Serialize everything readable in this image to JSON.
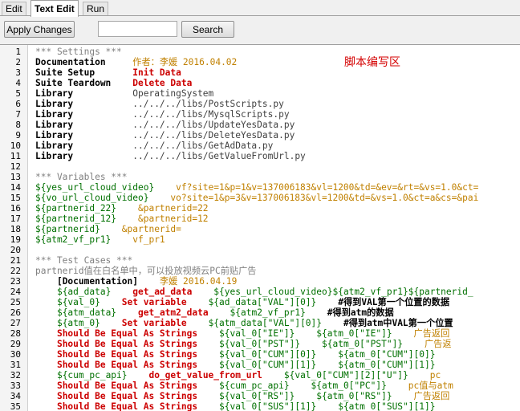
{
  "tabs": {
    "edit": "Edit",
    "text_edit": "Text Edit",
    "run": "Run"
  },
  "toolbar": {
    "apply": "Apply Changes",
    "search_value": "",
    "search": "Search"
  },
  "annotation": "脚本编写区",
  "lines": [
    [
      [
        "cmt",
        "*** Settings ***"
      ]
    ],
    [
      [
        "kw",
        "Documentation     "
      ],
      [
        "arg",
        "作者：李媛 2016.04.02"
      ]
    ],
    [
      [
        "kw",
        "Suite Setup       "
      ],
      [
        "red",
        "Init Data"
      ]
    ],
    [
      [
        "kw",
        "Suite Teardown    "
      ],
      [
        "red",
        "Delete Data"
      ]
    ],
    [
      [
        "kw",
        "Library           "
      ],
      [
        "plain",
        "OperatingSystem"
      ]
    ],
    [
      [
        "kw",
        "Library           "
      ],
      [
        "plain",
        "../../../libs/PostScripts.py"
      ]
    ],
    [
      [
        "kw",
        "Library           "
      ],
      [
        "plain",
        "../../../libs/MysqlScripts.py"
      ]
    ],
    [
      [
        "kw",
        "Library           "
      ],
      [
        "plain",
        "../../../libs/UpdateYesData.py"
      ]
    ],
    [
      [
        "kw",
        "Library           "
      ],
      [
        "plain",
        "../../../libs/DeleteYesData.py"
      ]
    ],
    [
      [
        "kw",
        "Library           "
      ],
      [
        "plain",
        "../../../libs/GetAdData.py"
      ]
    ],
    [
      [
        "kw",
        "Library           "
      ],
      [
        "plain",
        "../../../libs/GetValueFromUrl.py"
      ]
    ],
    [],
    [
      [
        "cmt",
        "*** Variables ***"
      ]
    ],
    [
      [
        "var",
        "${yes_url_cloud_video}    "
      ],
      [
        "arg",
        "vf?site=1&p=1&v=137006183&vl=1200&td=&ev=&rt=&vs=1.0&ct="
      ]
    ],
    [
      [
        "var",
        "${vo_url_cloud_video}    "
      ],
      [
        "arg",
        "vo?site=1&p=3&v=137006183&vl=1200&td=&vs=1.0&ct=a&cs=&pai"
      ]
    ],
    [
      [
        "var",
        "${partnerid_22}    "
      ],
      [
        "arg",
        "&partnerid=22"
      ]
    ],
    [
      [
        "var",
        "${partnerid_12}    "
      ],
      [
        "arg",
        "&partnerid=12"
      ]
    ],
    [
      [
        "var",
        "${partnerid}    "
      ],
      [
        "arg",
        "&partnerid="
      ]
    ],
    [
      [
        "var",
        "${atm2_vf_pr1}    "
      ],
      [
        "arg",
        "vf_pr1"
      ]
    ],
    [],
    [
      [
        "cmt",
        "*** Test Cases ***"
      ]
    ],
    [
      [
        "cmt",
        "partnerid值在白名单中，可以投放视频云PC前贴广告"
      ]
    ],
    [
      [
        "plain",
        "    "
      ],
      [
        "kw",
        "[Documentation]    "
      ],
      [
        "arg",
        "李媛 2016.04.19"
      ]
    ],
    [
      [
        "plain",
        "    "
      ],
      [
        "var",
        "${ad_data}    "
      ],
      [
        "red",
        "get_ad_data    "
      ],
      [
        "var",
        "${yes_url_cloud_video}${atm2_vf_pr1}${partnerid_"
      ]
    ],
    [
      [
        "plain",
        "    "
      ],
      [
        "var",
        "${val_0}    "
      ],
      [
        "red",
        "Set variable    "
      ],
      [
        "var",
        "${ad_data[\"VAL\"][0]}    "
      ],
      [
        "kw",
        "#得到VAL第一个位置的数据"
      ]
    ],
    [
      [
        "plain",
        "    "
      ],
      [
        "var",
        "${atm_data}    "
      ],
      [
        "red",
        "get_atm2_data    "
      ],
      [
        "var",
        "${atm2_vf_pr1}    "
      ],
      [
        "kw",
        "#得到atm的数据"
      ]
    ],
    [
      [
        "plain",
        "    "
      ],
      [
        "var",
        "${atm_0}    "
      ],
      [
        "red",
        "Set variable    "
      ],
      [
        "var",
        "${atm_data[\"VAL\"][0]}    "
      ],
      [
        "kw",
        "#得到atm中VAL第一个位置"
      ]
    ],
    [
      [
        "plain",
        "    "
      ],
      [
        "red",
        "Should Be Equal As Strings    "
      ],
      [
        "var",
        "${val_0[\"IE\"]}    ${atm_0[\"IE\"]}    "
      ],
      [
        "arg",
        "广告返回"
      ]
    ],
    [
      [
        "plain",
        "    "
      ],
      [
        "red",
        "Should Be Equal As Strings    "
      ],
      [
        "var",
        "${val_0[\"PST\"]}    ${atm_0[\"PST\"]}    "
      ],
      [
        "arg",
        "广告返"
      ]
    ],
    [
      [
        "plain",
        "    "
      ],
      [
        "red",
        "Should Be Equal As Strings    "
      ],
      [
        "var",
        "${val_0[\"CUM\"][0]}    ${atm_0[\"CUM\"][0]}"
      ]
    ],
    [
      [
        "plain",
        "    "
      ],
      [
        "red",
        "Should Be Equal As Strings    "
      ],
      [
        "var",
        "${val_0[\"CUM\"][1]}    ${atm_0[\"CUM\"][1]}"
      ]
    ],
    [
      [
        "plain",
        "    "
      ],
      [
        "var",
        "${cum_pc_api}    "
      ],
      [
        "red",
        "do_get_value_from_url    "
      ],
      [
        "var",
        "${val_0[\"CUM\"][2][\"U\"]}    "
      ],
      [
        "arg",
        "pc"
      ]
    ],
    [
      [
        "plain",
        "    "
      ],
      [
        "red",
        "Should Be Equal As Strings    "
      ],
      [
        "var",
        "${cum_pc_api}    ${atm_0[\"PC\"]}    "
      ],
      [
        "arg",
        "pc值与atm"
      ]
    ],
    [
      [
        "plain",
        "    "
      ],
      [
        "red",
        "Should Be Equal As Strings    "
      ],
      [
        "var",
        "${val_0[\"RS\"]}    ${atm_0[\"RS\"]}    "
      ],
      [
        "arg",
        "广告返回"
      ]
    ],
    [
      [
        "plain",
        "    "
      ],
      [
        "red",
        "Should Be Equal As Strings    "
      ],
      [
        "var",
        "${val_0[\"SUS\"][1]}    ${atm_0[\"SUS\"][1]}"
      ]
    ]
  ]
}
